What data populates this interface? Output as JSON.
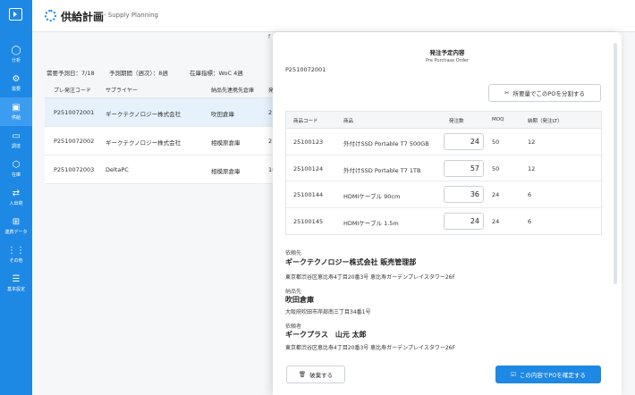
{
  "sidebar": {
    "items": [
      {
        "label": "分析",
        "icon": "◯"
      },
      {
        "label": "需要",
        "icon": "⚙"
      },
      {
        "label": "供給",
        "icon": "▣"
      },
      {
        "label": "調達",
        "icon": "▭"
      },
      {
        "label": "在庫",
        "icon": "⬡"
      },
      {
        "label": "入出荷",
        "icon": "⇄"
      },
      {
        "label": "連携データ",
        "icon": "⊞"
      },
      {
        "label": "その他",
        "icon": "⋮⋮"
      },
      {
        "label": "基本設定",
        "icon": "☰"
      }
    ],
    "active_index": 2
  },
  "header": {
    "title": "供給計画",
    "subtitle": "- Supply Planning"
  },
  "filters": {
    "forecast_date": "需要予測日：7/18",
    "forecast_period": "予測期間（週次）：8週",
    "stock_indicator": "在庫指標：WoC 4週"
  },
  "top_chip": "f",
  "list": {
    "headers": [
      "プレ発注コード",
      "サプライヤー",
      "納品先連携先倉庫",
      "発"
    ],
    "rows": [
      [
        "P2510072001",
        "ギークテクノロジー株式会社",
        "吹田倉庫",
        "2"
      ],
      [
        "P2510072002",
        "ギークテクノロジー株式会社",
        "相模原倉庫",
        "2"
      ],
      [
        "P2510072003",
        "DeltaPC",
        "相模原倉庫",
        "1("
      ]
    ]
  },
  "modal": {
    "title": "発注予定内容",
    "subtitle": "Pre Purchase Order",
    "order_id": "P2510072001",
    "split_button": "所要量でこのPOを分割する",
    "table_headers": [
      "商品コード",
      "商品",
      "発注数",
      "MOQ",
      "納期（発注LT）"
    ],
    "items": [
      {
        "code": "25100123",
        "name": "外付けSSD Portable T7 500GB",
        "qty": "24",
        "moq": "50",
        "lt": "12"
      },
      {
        "code": "25100124",
        "name": "外付けSSD Portable T7 1TB",
        "qty": "57",
        "moq": "50",
        "lt": "12"
      },
      {
        "code": "25100144",
        "name": "HDMIケーブル 90cm",
        "qty": "36",
        "moq": "24",
        "lt": "6"
      },
      {
        "code": "25100145",
        "name": "HDMIケーブル 1.5m",
        "qty": "24",
        "moq": "24",
        "lt": "6"
      }
    ],
    "requestee_label": "依頼先",
    "requestee_name": "ギークテクノロジー株式会社 販売管理部",
    "requestee_address": "東京都渋谷区恵比寿4丁目20番3号 恵比寿ガーデンプレイスタワー26F",
    "delivery_label": "納品先",
    "delivery_name": "吹田倉庫",
    "delivery_address": "大阪府吹田市岸部南三丁目34番1号",
    "requester_label": "依頼者",
    "requester_name": "ギークプラス　山元 太郎",
    "requester_address": "東京都渋谷区恵比寿4丁目20番3号 恵比寿ガーデンプレイスタワー26F",
    "cancel_button": "破棄する",
    "confirm_button": "この内容でPOを確定する"
  }
}
